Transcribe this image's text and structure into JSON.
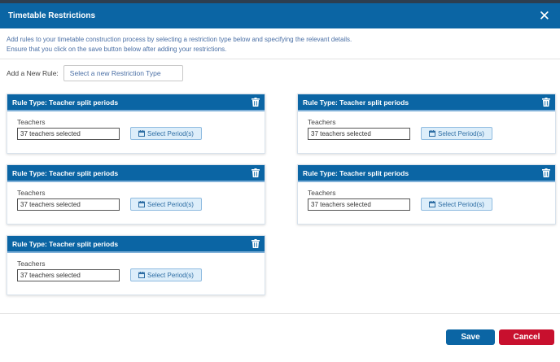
{
  "modal": {
    "title": "Timetable Restrictions",
    "close_glyph": "✕",
    "intro_line1": "Add rules to your timetable construction process by selecting a restriction type below and specifying the relevant details.",
    "intro_line2": "Ensure that you click on the save button below after adding your restrictions."
  },
  "add_rule": {
    "label": "Add a New Rule:",
    "select_placeholder": "Select a new Restriction Type"
  },
  "rules": [
    {
      "title": "Rule Type: Teacher split periods",
      "teachers_label": "Teachers",
      "teachers_value": "37 teachers selected",
      "period_button": "Select Period(s)"
    },
    {
      "title": "Rule Type: Teacher split periods",
      "teachers_label": "Teachers",
      "teachers_value": "37 teachers selected",
      "period_button": "Select Period(s)"
    },
    {
      "title": "Rule Type: Teacher split periods",
      "teachers_label": "Teachers",
      "teachers_value": "37 teachers selected",
      "period_button": "Select Period(s)"
    },
    {
      "title": "Rule Type: Teacher split periods",
      "teachers_label": "Teachers",
      "teachers_value": "37 teachers selected",
      "period_button": "Select Period(s)"
    },
    {
      "title": "Rule Type: Teacher split periods",
      "teachers_label": "Teachers",
      "teachers_value": "37 teachers selected",
      "period_button": "Select Period(s)"
    }
  ],
  "footer": {
    "save_label": "Save",
    "cancel_label": "Cancel"
  },
  "icons": {
    "delete": "trash-icon",
    "calendar": "calendar-icon",
    "close": "close-icon"
  },
  "colors": {
    "primary": "#0b65a4",
    "danger": "#c8102e",
    "secondary_button_bg": "#ddeefa"
  }
}
